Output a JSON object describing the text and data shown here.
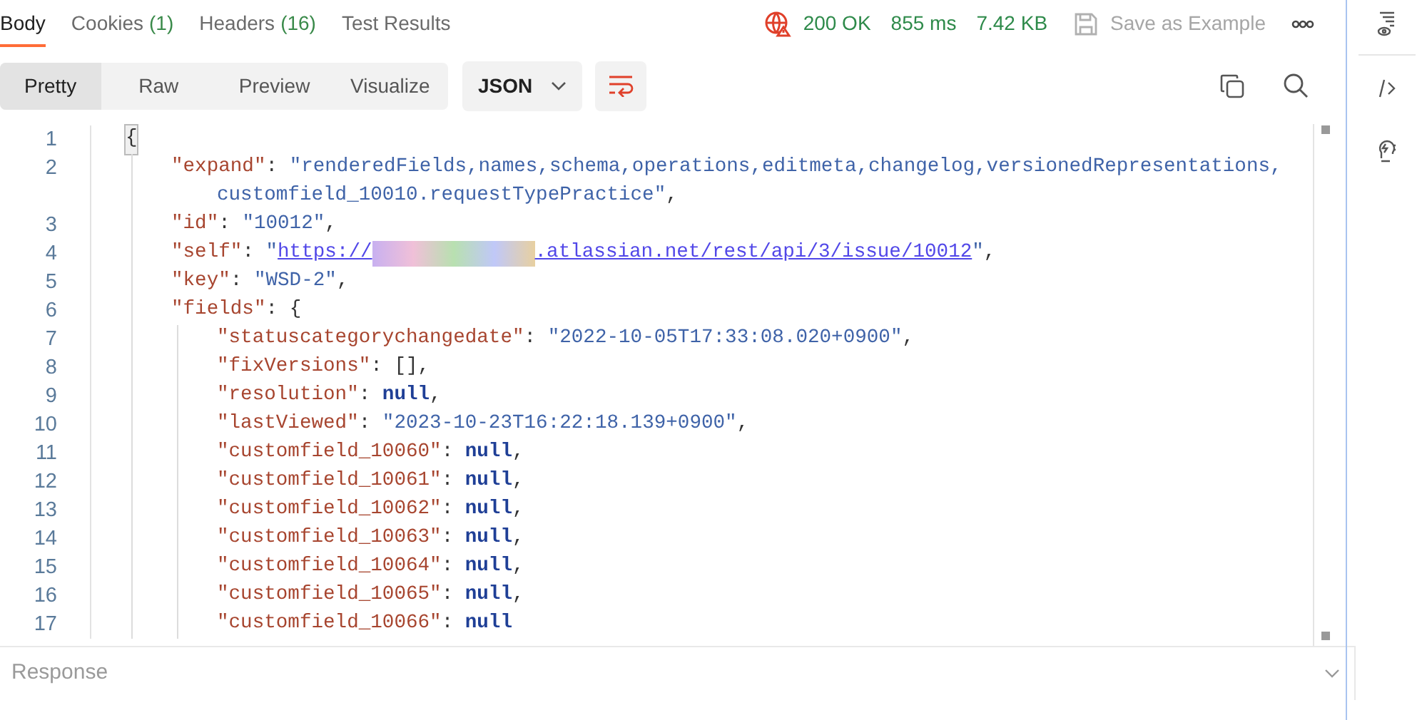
{
  "tabs": [
    {
      "label": "Body",
      "selected": true
    },
    {
      "label": "Cookies",
      "count": "(1)",
      "selected": false
    },
    {
      "label": "Headers",
      "count": "(16)",
      "selected": false
    },
    {
      "label": "Test Results",
      "selected": false
    }
  ],
  "status": {
    "code": "200 OK",
    "time": "855 ms",
    "size": "7.42 KB"
  },
  "save_button": {
    "label": "Save as Example",
    "disabled": true
  },
  "view_modes": [
    {
      "label": "Pretty",
      "selected": true
    },
    {
      "label": "Raw",
      "selected": false
    },
    {
      "label": "Preview",
      "selected": false
    },
    {
      "label": "Visualize",
      "selected": false
    }
  ],
  "format_dropdown": {
    "value": "JSON"
  },
  "code": [
    {
      "number": "1",
      "tokens": [
        {
          "kind": "brace",
          "text": "{",
          "highlighted": true
        }
      ],
      "children": [
        {
          "number": "2",
          "tokens": [
            {
              "kind": "key",
              "text": "\"expand\""
            },
            {
              "kind": "punct",
              "text": ": "
            },
            {
              "kind": "string",
              "text": "\"renderedFields,names,schema,operations,editmeta,changelog,versionedRepresentations,"
            }
          ],
          "continuation": [
            {
              "kind": "string",
              "text": "customfield_10010.requestTypePractice\""
            },
            {
              "kind": "punct",
              "text": ","
            }
          ]
        },
        {
          "number": "3",
          "tokens": [
            {
              "kind": "key",
              "text": "\"id\""
            },
            {
              "kind": "punct",
              "text": ": "
            },
            {
              "kind": "string",
              "text": "\"10012\""
            },
            {
              "kind": "punct",
              "text": ","
            }
          ]
        },
        {
          "number": "4",
          "tokens": [
            {
              "kind": "key",
              "text": "\"self\""
            },
            {
              "kind": "punct",
              "text": ": "
            },
            {
              "kind": "string",
              "text": "\""
            },
            {
              "kind": "link",
              "text": "https://"
            },
            {
              "kind": "redacted"
            },
            {
              "kind": "link",
              "text": ".atlassian.net/rest/api/3/issue/10012"
            },
            {
              "kind": "string",
              "text": "\""
            },
            {
              "kind": "punct",
              "text": ","
            }
          ]
        },
        {
          "number": "5",
          "tokens": [
            {
              "kind": "key",
              "text": "\"key\""
            },
            {
              "kind": "punct",
              "text": ": "
            },
            {
              "kind": "string",
              "text": "\"WSD-2\""
            },
            {
              "kind": "punct",
              "text": ","
            }
          ]
        },
        {
          "number": "6",
          "tokens": [
            {
              "kind": "key",
              "text": "\"fields\""
            },
            {
              "kind": "punct",
              "text": ": "
            },
            {
              "kind": "brace",
              "text": "{",
              "highlighted": false
            }
          ],
          "children": [
            {
              "number": "7",
              "tokens": [
                {
                  "kind": "key",
                  "text": "\"statuscategorychangedate\""
                },
                {
                  "kind": "punct",
                  "text": ": "
                },
                {
                  "kind": "string",
                  "text": "\"2022-10-05T17:33:08.020+0900\""
                },
                {
                  "kind": "punct",
                  "text": ","
                }
              ]
            },
            {
              "number": "8",
              "tokens": [
                {
                  "kind": "key",
                  "text": "\"fixVersions\""
                },
                {
                  "kind": "punct",
                  "text": ": []"
                },
                {
                  "kind": "punct",
                  "text": ","
                }
              ]
            },
            {
              "number": "9",
              "tokens": [
                {
                  "kind": "key",
                  "text": "\"resolution\""
                },
                {
                  "kind": "punct",
                  "text": ": "
                },
                {
                  "kind": "null",
                  "text": "null"
                },
                {
                  "kind": "punct",
                  "text": ","
                }
              ]
            },
            {
              "number": "10",
              "tokens": [
                {
                  "kind": "key",
                  "text": "\"lastViewed\""
                },
                {
                  "kind": "punct",
                  "text": ": "
                },
                {
                  "kind": "string",
                  "text": "\"2023-10-23T16:22:18.139+0900\""
                },
                {
                  "kind": "punct",
                  "text": ","
                }
              ]
            },
            {
              "number": "11",
              "tokens": [
                {
                  "kind": "key",
                  "text": "\"customfield_10060\""
                },
                {
                  "kind": "punct",
                  "text": ": "
                },
                {
                  "kind": "null",
                  "text": "null"
                },
                {
                  "kind": "punct",
                  "text": ","
                }
              ]
            },
            {
              "number": "12",
              "tokens": [
                {
                  "kind": "key",
                  "text": "\"customfield_10061\""
                },
                {
                  "kind": "punct",
                  "text": ": "
                },
                {
                  "kind": "null",
                  "text": "null"
                },
                {
                  "kind": "punct",
                  "text": ","
                }
              ]
            },
            {
              "number": "13",
              "tokens": [
                {
                  "kind": "key",
                  "text": "\"customfield_10062\""
                },
                {
                  "kind": "punct",
                  "text": ": "
                },
                {
                  "kind": "null",
                  "text": "null"
                },
                {
                  "kind": "punct",
                  "text": ","
                }
              ]
            },
            {
              "number": "14",
              "tokens": [
                {
                  "kind": "key",
                  "text": "\"customfield_10063\""
                },
                {
                  "kind": "punct",
                  "text": ": "
                },
                {
                  "kind": "null",
                  "text": "null"
                },
                {
                  "kind": "punct",
                  "text": ","
                }
              ]
            },
            {
              "number": "15",
              "tokens": [
                {
                  "kind": "key",
                  "text": "\"customfield_10064\""
                },
                {
                  "kind": "punct",
                  "text": ": "
                },
                {
                  "kind": "null",
                  "text": "null"
                },
                {
                  "kind": "punct",
                  "text": ","
                }
              ]
            },
            {
              "number": "16",
              "tokens": [
                {
                  "kind": "key",
                  "text": "\"customfield_10065\""
                },
                {
                  "kind": "punct",
                  "text": ": "
                },
                {
                  "kind": "null",
                  "text": "null"
                },
                {
                  "kind": "punct",
                  "text": ","
                }
              ]
            },
            {
              "number": "17",
              "tokens": [
                {
                  "kind": "key",
                  "text": "\"customfield_10066\""
                },
                {
                  "kind": "punct",
                  "text": ": "
                },
                {
                  "kind": "null",
                  "text": "null"
                }
              ]
            }
          ]
        }
      ]
    }
  ],
  "response_bar": {
    "label": "Response"
  }
}
